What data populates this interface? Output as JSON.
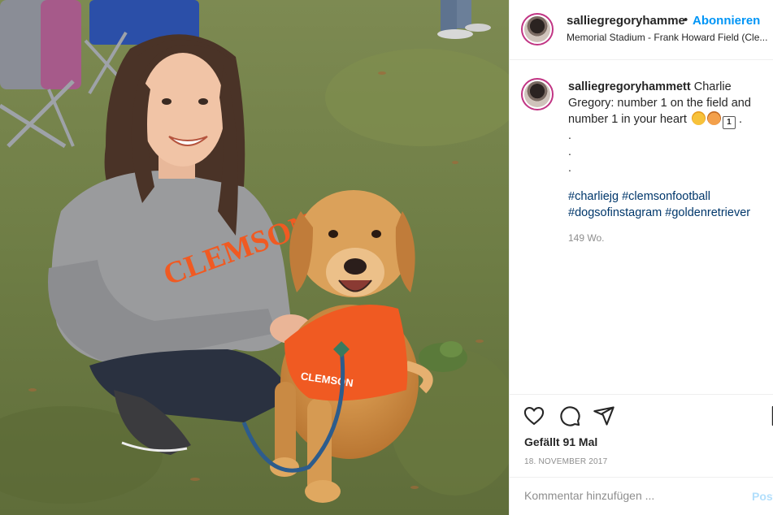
{
  "header": {
    "username": "salliegregoryhamme",
    "dot": "•",
    "follow_label": "Abonnieren",
    "location": "Memorial Stadium - Frank Howard Field (Cle..."
  },
  "caption": {
    "username": "salliegregoryhammett",
    "text": "Charlie Gregory: number 1 on the field and number 1 in your heart",
    "badge_number": "1",
    "trailing": ".",
    "dot_lines": [
      ".",
      ".",
      "."
    ],
    "hashtags": [
      "#charliejg",
      "#clemsonfootball",
      "#dogsofinstagram",
      "#goldenretriever"
    ],
    "age": "149 Wo."
  },
  "actions": {
    "like_icon": "heart-icon",
    "comment_icon": "comment-icon",
    "share_icon": "share-icon",
    "likes": "Gefällt 91 Mal",
    "date": "18. NOVEMBER 2017"
  },
  "comment": {
    "placeholder": "Kommentar hinzufügen ...",
    "post_label": "Posten"
  },
  "photo": {
    "sweatshirt_text": "CLEMSON",
    "dog_shirt_text": "CLEMSON"
  },
  "colors": {
    "link": "#0095f6",
    "hashtag": "#00376b",
    "muted": "#8e8e8e",
    "clemson_orange": "#f05a22"
  }
}
